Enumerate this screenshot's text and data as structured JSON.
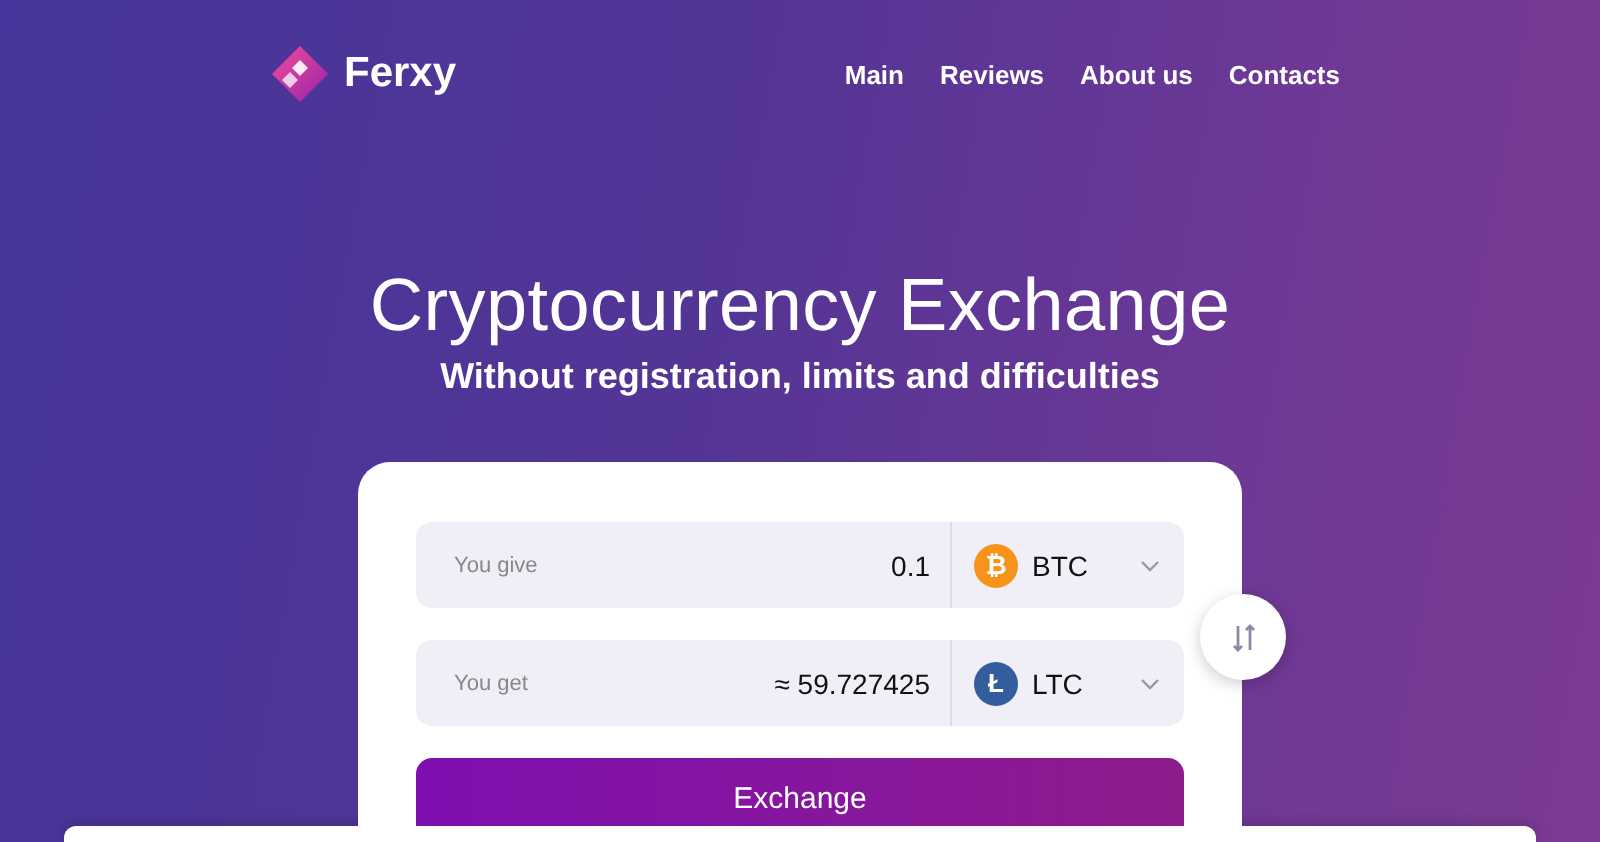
{
  "header": {
    "logo_text": "Ferxy",
    "nav": [
      {
        "label": "Main"
      },
      {
        "label": "Reviews"
      },
      {
        "label": "About us"
      },
      {
        "label": "Contacts"
      }
    ]
  },
  "hero": {
    "title": "Cryptocurrency Exchange",
    "subtitle": "Without registration, limits and difficulties"
  },
  "exchange": {
    "rows": [
      {
        "label": "You give",
        "amount": "0.1",
        "currency": "BTC",
        "symbol": "₿",
        "color": "#f7931a"
      },
      {
        "label": "You get",
        "amount": "≈ 59.727425",
        "currency": "LTC",
        "symbol": "Ł",
        "color": "#345d9d"
      }
    ],
    "submit": "Exchange"
  }
}
